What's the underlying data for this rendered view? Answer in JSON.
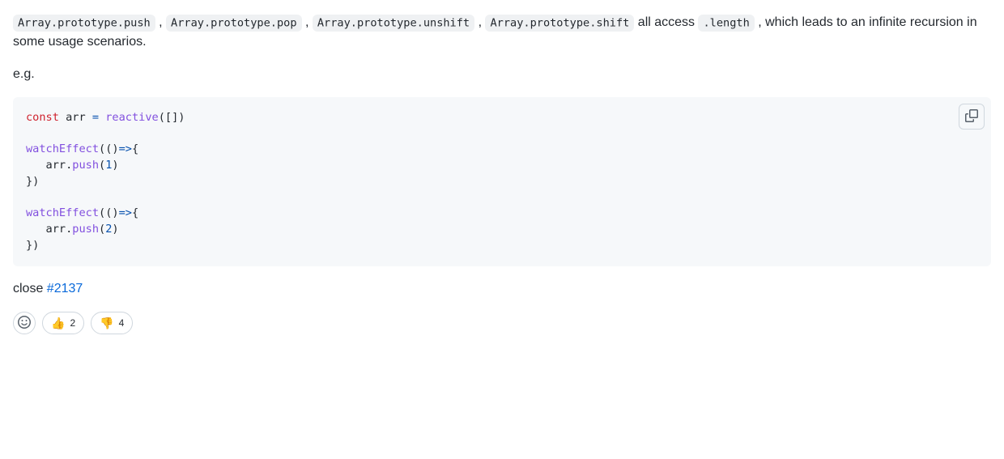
{
  "para1": {
    "codes": [
      "Array.prototype.push",
      "Array.prototype.pop",
      "Array.prototype.unshift",
      "Array.prototype.shift"
    ],
    "sep": " , ",
    "after_codes": "  all access ",
    "length_code": ".length",
    "tail": " , which leads to an infinite recursion in some usage scenarios."
  },
  "eg_label": "e.g.",
  "code": {
    "l1": {
      "kw": "const",
      "sp1": " arr ",
      "op": "=",
      "sp2": " ",
      "fn": "reactive",
      "tail": "([])"
    },
    "blank": "",
    "l2a": {
      "fn": "watchEffect",
      "paren": "(()",
      "arrow": "=>",
      "brace": "{"
    },
    "l2b": {
      "indent": "   arr.",
      "fn": "push",
      "open": "(",
      "num": "1",
      "close": ")"
    },
    "l2c": "})",
    "l3a": {
      "fn": "watchEffect",
      "paren": "(()",
      "arrow": "=>",
      "brace": "{"
    },
    "l3b": {
      "indent": "   arr.",
      "fn": "push",
      "open": "(",
      "num": "2",
      "close": ")"
    },
    "l3c": "})"
  },
  "close": {
    "prefix": "close ",
    "link": "#2137"
  },
  "reactions": {
    "thumbs_up": {
      "emoji": "👍",
      "count": "2"
    },
    "thumbs_down": {
      "emoji": "👎",
      "count": "4"
    }
  }
}
